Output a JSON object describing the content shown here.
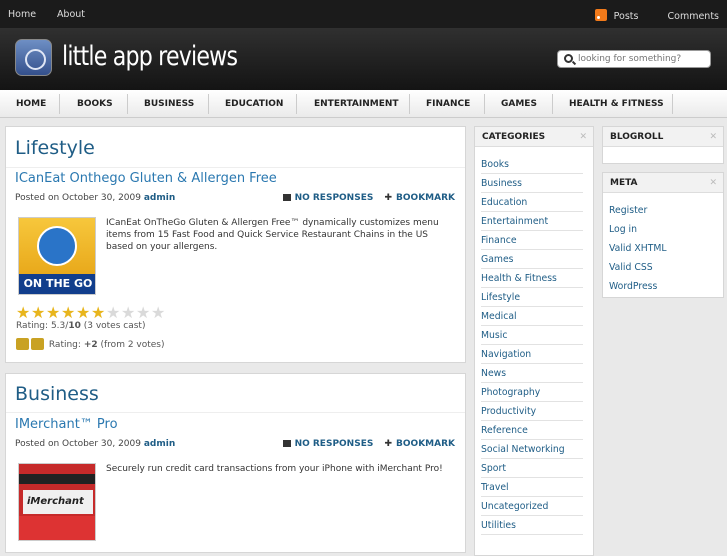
{
  "topbar": {
    "links": [
      "Home",
      "About"
    ],
    "posts": "Posts",
    "comments": "Comments"
  },
  "site": {
    "title": "little app reviews",
    "search_placeholder": "looking for something?"
  },
  "nav": [
    "HOME",
    "BOOKS",
    "BUSINESS",
    "EDUCATION",
    "ENTERTAINMENT",
    "FINANCE",
    "GAMES",
    "HEALTH & FITNESS"
  ],
  "posts": [
    {
      "category": "Lifestyle",
      "title": "ICanEat Onthego Gluten & Allergen Free",
      "date": "Posted on October 30, 2009",
      "author": "admin",
      "responses": "NO RESPONSES",
      "bookmark": "BOOKMARK",
      "excerpt": "ICanEat OnTheGo Gluten & Allergen Free™ dynamically customizes menu items from 15 Fast Food and Quick Service Restaurant Chains in the US based on your allergens.",
      "thumb_text": "ON THE GO",
      "rating": {
        "label": "Rating:",
        "value": "5.3",
        "max": "10",
        "votes": "(3 votes cast)",
        "stars": 5.3
      },
      "thumbs": {
        "label": "Rating:",
        "value": "+2",
        "votes": "(from 2 votes)"
      }
    },
    {
      "category": "Business",
      "title": "IMerchant™ Pro",
      "date": "Posted on October 30, 2009",
      "author": "admin",
      "responses": "NO RESPONSES",
      "bookmark": "BOOKMARK",
      "excerpt": "Securely run credit card transactions from your iPhone with iMerchant Pro!",
      "thumb_text": "iMerchant"
    }
  ],
  "categories": {
    "heading": "CATEGORIES",
    "items": [
      "Books",
      "Business",
      "Education",
      "Entertainment",
      "Finance",
      "Games",
      "Health & Fitness",
      "Lifestyle",
      "Medical",
      "Music",
      "Navigation",
      "News",
      "Photography",
      "Productivity",
      "Reference",
      "Social Networking",
      "Sport",
      "Travel",
      "Uncategorized",
      "Utilities"
    ]
  },
  "blogroll": {
    "heading": "BLOGROLL"
  },
  "meta": {
    "heading": "META",
    "items": [
      "Register",
      "Log in",
      "Valid XHTML",
      "Valid CSS",
      "WordPress"
    ]
  },
  "colors": {
    "link": "#1f5d86",
    "title": "#2a78b0",
    "star": "#e8b51c"
  }
}
